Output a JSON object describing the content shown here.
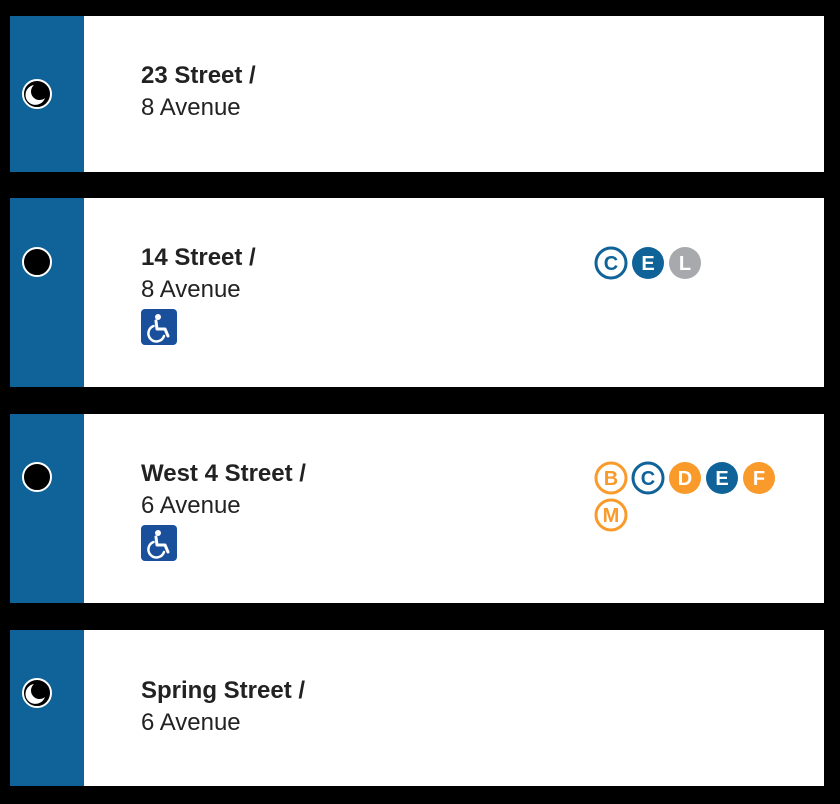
{
  "colors": {
    "rail": "#0f6399",
    "line_blue": "#0f6399",
    "line_orange": "#f99a2b",
    "line_gray": "#a7a9ac",
    "ada_blue": "#1a4f9c"
  },
  "stations": [
    {
      "name": "23 Street /",
      "cross_street": "8 Avenue",
      "stop_icon": "part-time-stop-icon",
      "accessible": false,
      "routes": []
    },
    {
      "name": "14 Street /",
      "cross_street": "8 Avenue",
      "stop_icon": "full-time-stop-icon",
      "accessible": true,
      "routes": [
        {
          "letter": "C",
          "style": "outline",
          "color": "#0f6399"
        },
        {
          "letter": "E",
          "style": "filled",
          "color": "#0f6399"
        },
        {
          "letter": "L",
          "style": "filled",
          "color": "#a7a9ac"
        }
      ]
    },
    {
      "name": "West 4 Street /",
      "cross_street": "6 Avenue",
      "stop_icon": "full-time-stop-icon",
      "accessible": true,
      "routes": [
        {
          "letter": "B",
          "style": "outline",
          "color": "#f99a2b"
        },
        {
          "letter": "C",
          "style": "outline",
          "color": "#0f6399"
        },
        {
          "letter": "D",
          "style": "filled",
          "color": "#f99a2b"
        },
        {
          "letter": "E",
          "style": "filled",
          "color": "#0f6399"
        },
        {
          "letter": "F",
          "style": "filled",
          "color": "#f99a2b"
        },
        {
          "letter": "M",
          "style": "outline",
          "color": "#f99a2b"
        }
      ]
    },
    {
      "name": "Spring Street /",
      "cross_street": "6 Avenue",
      "stop_icon": "part-time-stop-icon",
      "accessible": false,
      "routes": []
    }
  ]
}
